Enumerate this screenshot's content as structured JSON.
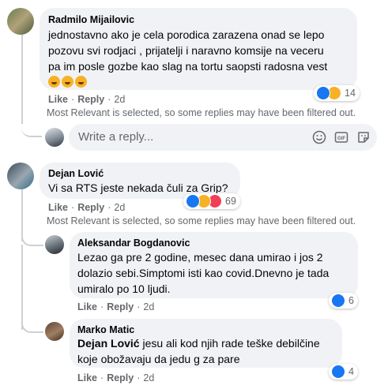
{
  "comments": [
    {
      "author": "Radmilo Mijailovic",
      "lines": [
        "jednostavno ako je cela porodica zarazena onad se lepo",
        "pozovu svi rodjaci , prijatelji i naravno komsije na veceru",
        "pa im posle gozbe kao slag na tortu saopsti radosna vest"
      ],
      "like": "Like",
      "reply": "Reply",
      "time": "2d",
      "reaction_count": "14"
    },
    {
      "author": "Dejan Lović",
      "lines": [
        "Vi sa RTS jeste nekada čuli za Grip?"
      ],
      "like": "Like",
      "reply": "Reply",
      "time": "2d",
      "reaction_count": "69"
    }
  ],
  "replies": [
    {
      "author": "Aleksandar Bogdanovic",
      "lines": [
        "Lezao ga pre 2 godine, mesec dana umirao i jos 2",
        "dolazio sebi.Simptomi isti kao covid.Dnevno je tada",
        "umiralo po 10 ljudi."
      ],
      "like": "Like",
      "reply": "Reply",
      "time": "2d",
      "reaction_count": "6"
    },
    {
      "author": "Marko Matic",
      "mention": "Dejan Lović",
      "lines": [
        " jesu ali kod njih rade teške debilčine",
        "koje obožavaju da jedu g za pare"
      ],
      "like": "Like",
      "reply": "Reply",
      "time": "2d",
      "reaction_count": "4"
    }
  ],
  "filter_note": "Most Relevant is selected, so some replies may have been filtered out.",
  "reply_box": {
    "placeholder": "Write a reply..."
  },
  "icons": [
    "smiley-icon",
    "gif-icon",
    "sticker-icon",
    "like-reaction-icon",
    "haha-reaction-icon",
    "love-reaction-icon"
  ],
  "colors": {
    "bubble": "#f0f2f5",
    "meta": "#65676b",
    "like_blue": "#1877f2"
  }
}
